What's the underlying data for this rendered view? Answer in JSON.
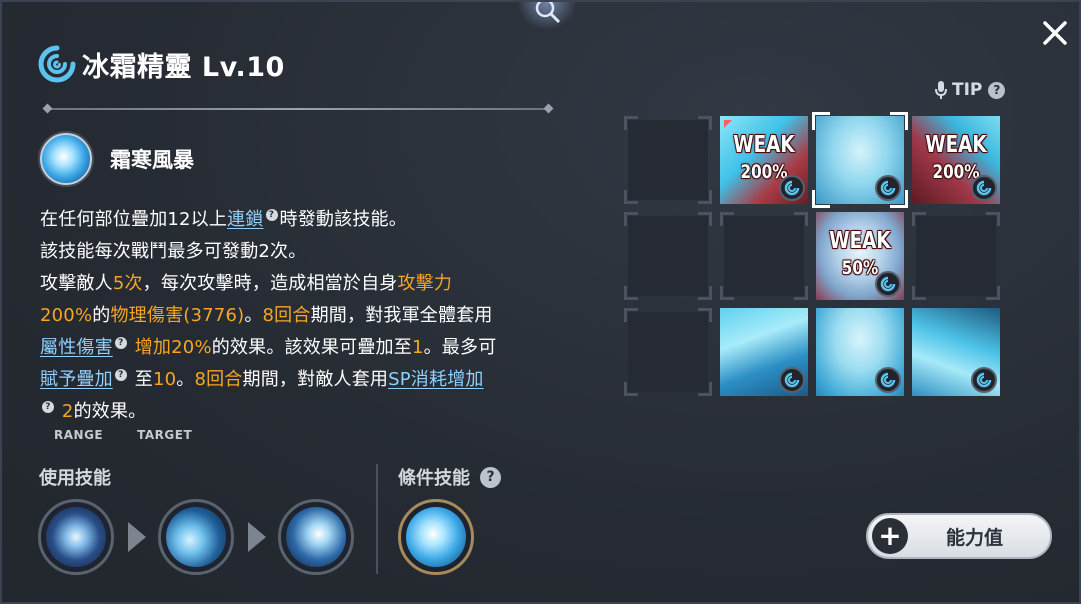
{
  "header": {
    "element_icon": "ice-swirl-icon",
    "title": "冰霜精靈 Lv.10",
    "close_icon": "close-icon"
  },
  "skill": {
    "name": "霜寒風暴",
    "icon": "ice-burst-icon"
  },
  "description": {
    "l1_a": "在任何部位疊加12以上",
    "l1_link": "連鎖",
    "l1_b": "時發動該技能。",
    "l2": "該技能每次戰鬥最多可發動2次。",
    "l3_a": "攻擊敵人",
    "l3_hl1": "5次",
    "l3_b": "，每次攻擊時，造成相當於自身",
    "l3_hl2": "攻擊力",
    "l4_hl1": "200%",
    "l4_a": "的",
    "l4_hl2": "物理傷害(3776)",
    "l4_b": "。",
    "l4_hl3": "8回合",
    "l4_c": "期間，對我軍全體套用",
    "l5_link": "屬性傷害",
    "l5_hl1": "增加20%",
    "l5_a": "的效果。該效果可疊加至",
    "l5_hl2": "1",
    "l5_b": "。最多可",
    "l6_link1": "賦予疊加",
    "l6_a": "至",
    "l6_hl1": "10",
    "l6_b": "。",
    "l6_hl2": "8回合",
    "l6_c": "期間，對敵人套用",
    "l6_link2": "SP消耗增加",
    "l7_hl": "2",
    "l7_a": "的效果。",
    "help_mark": "?"
  },
  "tags": {
    "range": "RANGE",
    "target": "TARGET"
  },
  "use_skills": {
    "label": "使用技能",
    "items": [
      "ice-shatter-icon",
      "ice-shard-icon",
      "ice-feather-icon"
    ]
  },
  "condition_skills": {
    "label": "條件技能",
    "help": "?",
    "items": [
      "ice-burst-icon"
    ]
  },
  "tip": {
    "label": "TIP",
    "help": "?",
    "icon": "microphone-icon"
  },
  "body_parts": [
    {
      "weak": "WEAK",
      "percent": "200%"
    },
    {
      "selected": true
    },
    {
      "weak": "WEAK",
      "percent": "200%"
    },
    {
      "weak": "WEAK",
      "percent": "50%"
    }
  ],
  "stats_button": {
    "label": "能力值",
    "icon": "plus-icon"
  },
  "colors": {
    "accent_orange": "#f5a623",
    "link_blue": "#8fd0ff",
    "panel_bg": "#262b33"
  }
}
